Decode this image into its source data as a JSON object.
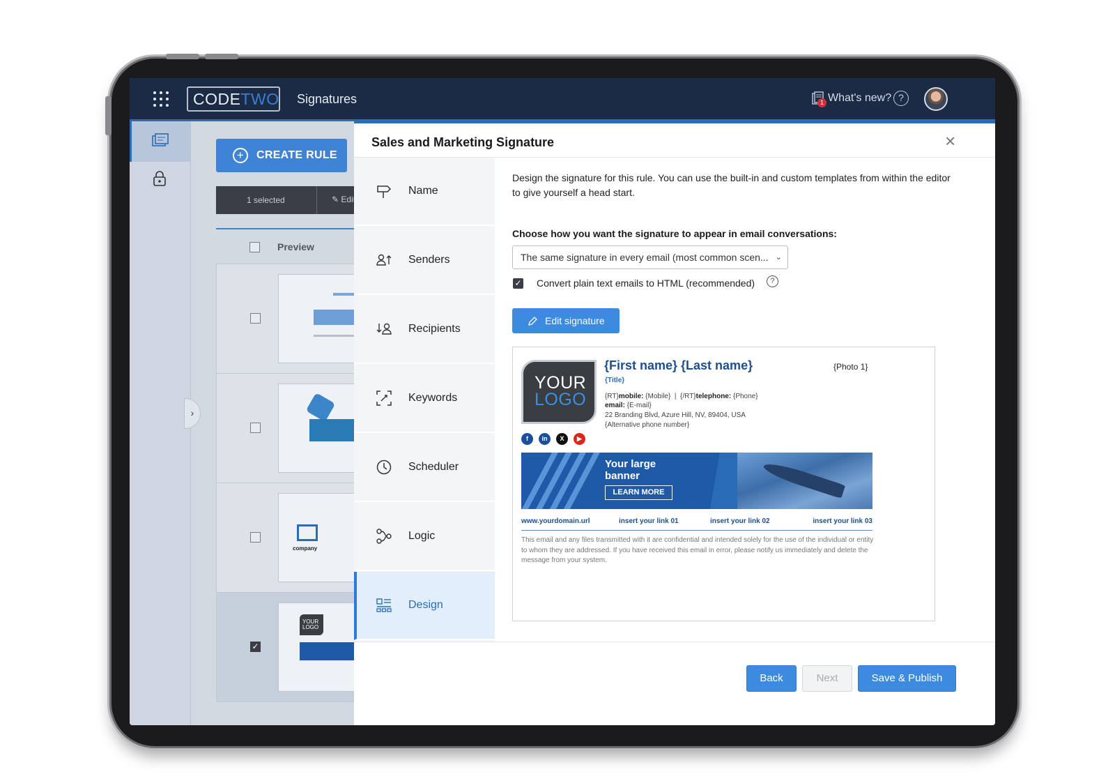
{
  "app": {
    "logo_text_a": "CODE",
    "logo_text_b": "TWO",
    "title": "Signatures",
    "whats_new": "What's new?",
    "whats_new_badge": "1",
    "help": "?"
  },
  "background": {
    "create_rule": "CREATE RULE",
    "selected": "1 selected",
    "edit": "Edit",
    "preview_header": "Preview",
    "thumb_company": "company",
    "thumb_your": "YOUR",
    "thumb_logo": "LOGO"
  },
  "modal": {
    "title": "Sales and Marketing Signature",
    "close": "×",
    "steps": [
      {
        "label": "Name",
        "icon": "signpost-icon"
      },
      {
        "label": "Senders",
        "icon": "senders-icon"
      },
      {
        "label": "Recipients",
        "icon": "recipients-icon"
      },
      {
        "label": "Keywords",
        "icon": "keywords-icon"
      },
      {
        "label": "Scheduler",
        "icon": "clock-icon"
      },
      {
        "label": "Logic",
        "icon": "logic-icon"
      },
      {
        "label": "Design",
        "icon": "design-icon",
        "active": true
      }
    ],
    "intro": "Design the signature for this rule. You can use the built-in and custom templates from within the editor to give yourself a head start.",
    "choose_label": "Choose how you want the signature to appear in email conversations:",
    "select_value": "The same signature in every email (most common scen...",
    "convert_label": "Convert plain text emails to HTML (recommended)",
    "convert_checked": true,
    "edit_signature": "Edit signature",
    "buttons": {
      "back": "Back",
      "next": "Next",
      "save": "Save & Publish"
    }
  },
  "signature": {
    "logo_line1": "YOUR",
    "logo_line2": "LOGO",
    "name": "{First name} {Last name}",
    "title": "{Title}",
    "photo": "{Photo 1}",
    "line_rt_open": "{RT}",
    "mobile_label": "mobile:",
    "mobile_value": " {Mobile}  |  {/RT}",
    "telephone_label": "telephone:",
    "telephone_value": " {Phone}",
    "email_label": "email:",
    "email_value": " {E-mail}",
    "address": "22 Branding Blvd, Azure Hill, NV, 89404, USA",
    "alt_phone": "{Alternative phone number}",
    "banner_title": "Your large banner",
    "banner_cta": "LEARN MORE",
    "links": [
      "www.yourdomain.url",
      "insert your link 01",
      "insert your link 02",
      "insert your link 03"
    ],
    "disclaimer": "This email and any files transmitted with it are confidential and intended solely for the use of the individual or entity to whom they are addressed. If you have received this email in error, please notify us immediately and delete the message from your system.",
    "socials": [
      {
        "icon": "facebook-icon",
        "glyph": "f",
        "color": "#1a4f9c"
      },
      {
        "icon": "linkedin-icon",
        "glyph": "in",
        "color": "#1a4f9c"
      },
      {
        "icon": "x-icon",
        "glyph": "X",
        "color": "#111111"
      },
      {
        "icon": "youtube-icon",
        "glyph": "▶",
        "color": "#e0241b"
      }
    ]
  },
  "colors": {
    "accent": "#3d8be0",
    "topbar": "#1c2b45",
    "signature_blue": "#1f4f8c"
  }
}
